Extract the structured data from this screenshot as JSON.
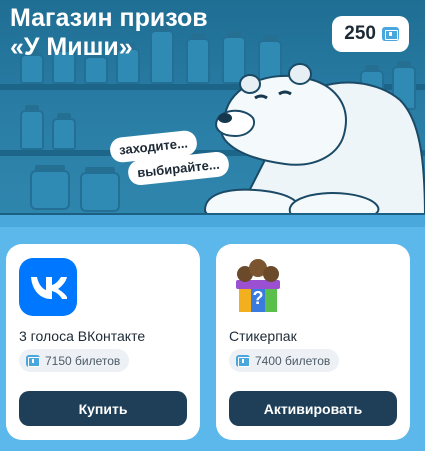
{
  "header": {
    "title_line1": "Магазин призов",
    "title_line2": "«У Миши»"
  },
  "balance": {
    "amount": "250",
    "icon": "ticket-icon"
  },
  "speech": {
    "line1": "заходите...",
    "line2": "выбирайте..."
  },
  "prizes": [
    {
      "name": "3 голоса ВКонтакте",
      "price": "7150 билетов",
      "button_label": "Купить",
      "icon": "vk-logo-icon"
    },
    {
      "name": "Стикерпак",
      "price": "7400 билетов",
      "button_label": "Активировать",
      "icon": "gift-box-icon"
    }
  ],
  "colors": {
    "background": "#5cb7ea",
    "banner": "#2a7ea6",
    "button": "#1e3f57",
    "vk_blue": "#0077ff",
    "ticket": "#4aa7de"
  }
}
